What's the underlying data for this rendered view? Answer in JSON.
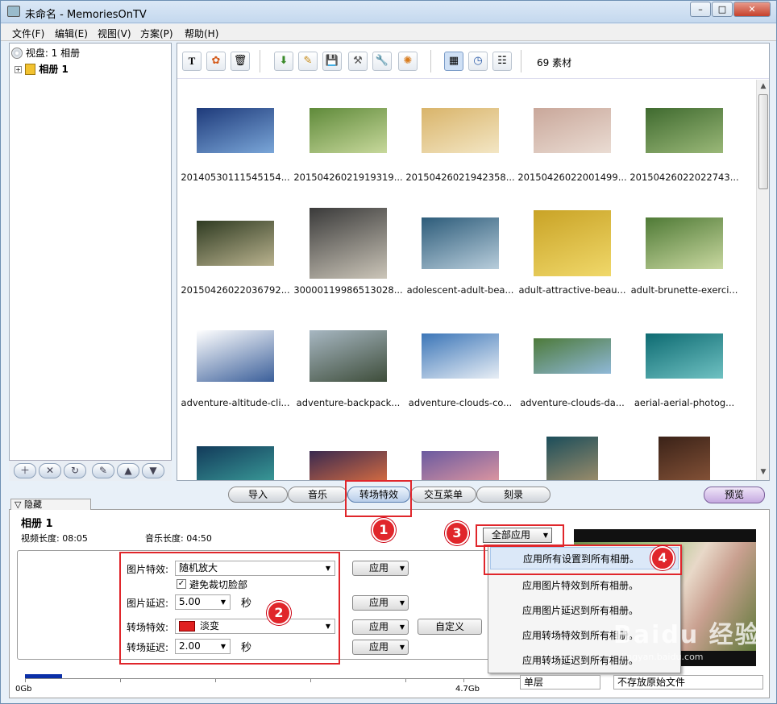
{
  "window": {
    "title": "未命名 - MemoriesOnTV",
    "minimize": "–",
    "maximize": "□",
    "close": "✕"
  },
  "menu": [
    "文件(F)",
    "编辑(E)",
    "视图(V)",
    "方案(P)",
    "帮助(H)"
  ],
  "tree": {
    "disc": "视盘: 1 相册",
    "album": "相册 1"
  },
  "left_tools": [
    "＋",
    "✕",
    "↻",
    "✎",
    "▲",
    "▼"
  ],
  "toolbar": {
    "count": "69 素材"
  },
  "thumbnails": [
    {
      "caption": "20140530111545154...",
      "colors": [
        "#1e3a7a",
        "#7aa6d8"
      ]
    },
    {
      "caption": "20150426021919319...",
      "colors": [
        "#5f8a3a",
        "#c7d89b"
      ]
    },
    {
      "caption": "20150426021942358...",
      "colors": [
        "#d9b46a",
        "#f3e6c4"
      ]
    },
    {
      "caption": "20150426022001499...",
      "colors": [
        "#c9a79a",
        "#eadcd3"
      ]
    },
    {
      "caption": "20150426022022743...",
      "colors": [
        "#3f6a2f",
        "#9ab878"
      ]
    },
    {
      "caption": "20150426022036792...",
      "colors": [
        "#2f3b22",
        "#b9b28e"
      ]
    },
    {
      "caption": "30000119986513028...",
      "colors": [
        "#3a3a3a",
        "#cbc5b8"
      ]
    },
    {
      "caption": "adolescent-adult-bea...",
      "colors": [
        "#2d5c7a",
        "#b8cddb"
      ]
    },
    {
      "caption": "adult-attractive-beau...",
      "colors": [
        "#c9a326",
        "#f0d86a"
      ]
    },
    {
      "caption": "adult-brunette-exerci...",
      "colors": [
        "#4f7a36",
        "#c9d8a0"
      ]
    },
    {
      "caption": "adventure-altitude-cli...",
      "colors": [
        "#ffffff",
        "#3b5f9a"
      ]
    },
    {
      "caption": "adventure-backpack...",
      "colors": [
        "#a7b7c2",
        "#3e4d3a"
      ]
    },
    {
      "caption": "adventure-clouds-co...",
      "colors": [
        "#3c76b8",
        "#e8eef5"
      ]
    },
    {
      "caption": "adventure-clouds-da...",
      "colors": [
        "#4d7a3a",
        "#8fb8d8"
      ]
    },
    {
      "caption": "aerial-aerial-photog...",
      "colors": [
        "#0e6b72",
        "#6fc1c2"
      ]
    },
    {
      "caption": "",
      "colors": [
        "#123a5a",
        "#3fa7a0"
      ]
    },
    {
      "caption": "",
      "colors": [
        "#3a2a50",
        "#e07040"
      ]
    },
    {
      "caption": "",
      "colors": [
        "#6a5aa0",
        "#e69aa0"
      ]
    },
    {
      "caption": "",
      "colors": [
        "#1b4d5a",
        "#c2a070"
      ]
    },
    {
      "caption": "",
      "colors": [
        "#3a2218",
        "#9a6040"
      ]
    }
  ],
  "tabs": [
    "导入",
    "音乐",
    "转场特效",
    "交互菜单",
    "刻录"
  ],
  "preview_button": "预览",
  "hide_tab": "隐藏",
  "album_panel": {
    "title": "相册 1",
    "video_length_label": "视频长度: 08:05",
    "music_length_label": "音乐长度: 04:50",
    "picture_effect_label": "图片特效:",
    "picture_effect_value": "随机放大",
    "avoid_crop_label": "避免裁切脸部",
    "picture_delay_label": "图片延迟:",
    "picture_delay_value": "5.00",
    "seconds_1": "秒",
    "transition_label": "转场特效:",
    "transition_value": "淡变",
    "transition_delay_label": "转场延迟:",
    "transition_delay_value": "2.00",
    "seconds_2": "秒",
    "apply": "应用",
    "custom": "自定义",
    "apply_all": "全部应用"
  },
  "apply_all_menu": [
    "应用所有设置到所有相册。",
    "应用图片特效到所有相册。",
    "应用图片延迟到所有相册。",
    "应用转场特效到所有相册。",
    "应用转场延迟到所有相册。"
  ],
  "capacity": {
    "start": "0Gb",
    "end": "4.7Gb",
    "used_fraction": 0.07
  },
  "bottom_combos": {
    "layer": "单层",
    "source": "不存放原始文件"
  },
  "badges": [
    "1",
    "2",
    "3",
    "4"
  ],
  "watermark": {
    "logo": "Baidu 经验",
    "url": "jingyan.baidu.com"
  }
}
